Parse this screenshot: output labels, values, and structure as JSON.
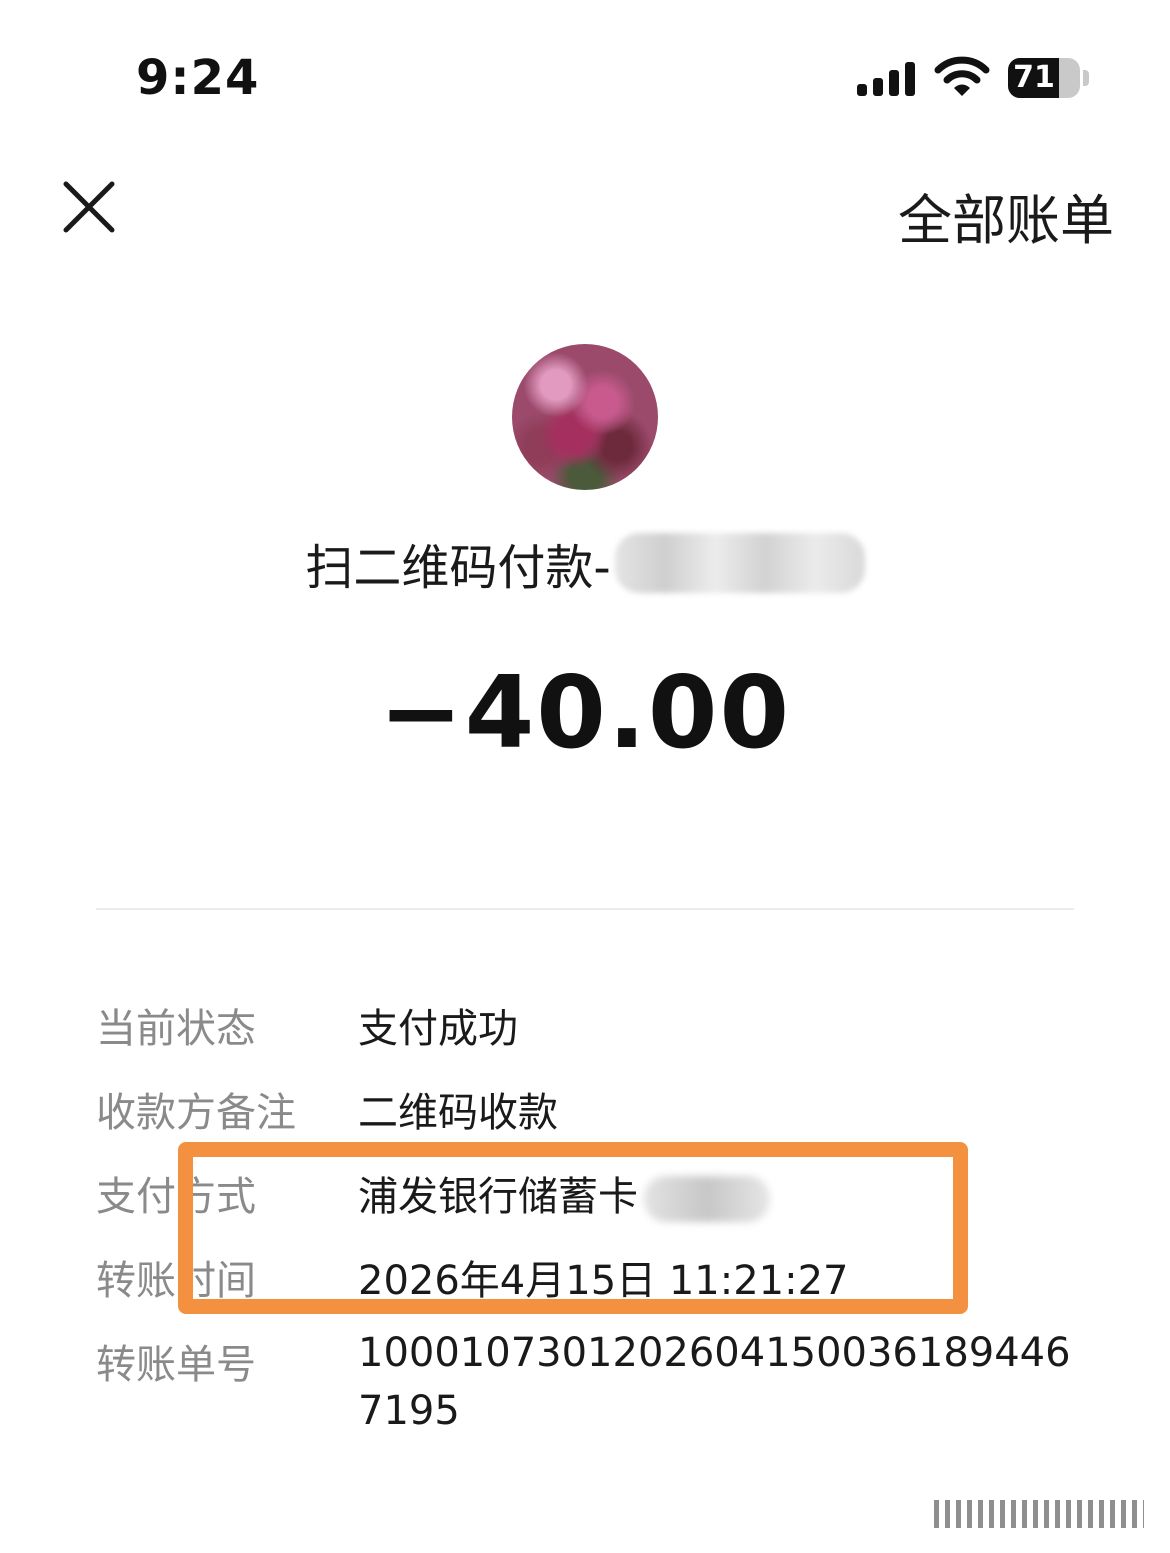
{
  "status_bar": {
    "time": "9:24",
    "battery_level": "71",
    "battery_fraction": 0.71
  },
  "header": {
    "close_icon": "close-icon",
    "all_bills_label": "全部账单"
  },
  "merchant": {
    "title": "扫二维码付款-",
    "avatar": "merchant-avatar"
  },
  "amount": "−40.00",
  "details": {
    "status": {
      "label": "当前状态",
      "value": "支付成功"
    },
    "payee_note": {
      "label": "收款方备注",
      "value": "二维码收款"
    },
    "payment_method": {
      "label": "支付方式",
      "value": "浦发银行储蓄卡"
    },
    "transfer_time": {
      "label": "转账时间",
      "value": "2026年4月15日 11:21:27"
    },
    "transfer_no": {
      "label": "转账单号",
      "value": "1000107301202604150036189446 7195"
    }
  },
  "colors": {
    "highlight": "#f39140",
    "label_gray": "#8a8a8a",
    "text": "#1a1a1a"
  }
}
